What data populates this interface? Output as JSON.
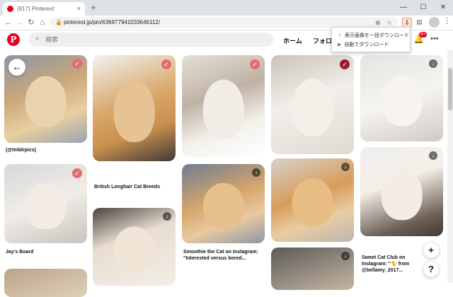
{
  "browser": {
    "tab_title": "(817) Pinterest",
    "tab_close": "×",
    "new_tab": "+",
    "url": "pinterest.jp/pin/636977941033646112/",
    "win_min": "—",
    "win_max": "☐",
    "win_close": "✕"
  },
  "pinterest": {
    "logo": "P",
    "search_placeholder": "検索",
    "nav_home": "ホーム",
    "nav_following": "フォロー",
    "notification_badge": "9+",
    "more": "•••"
  },
  "extension_menu": {
    "items": [
      {
        "icon": "download-icon",
        "label": "表示画像を一括ダウンロード"
      },
      {
        "icon": "play-icon",
        "label": "自動でダウンロード"
      }
    ]
  },
  "pins": {
    "captions": {
      "c1": "(@tmblrpics)",
      "c2": "British Longhair Cat Breeds",
      "c3": "Jay's Board",
      "c4": "Smoothie the Cat on Instagram: \"Interested versus bored...",
      "c5": "Sweet Cat Club on Instagram: \"🐈 from @bellamy_2017..."
    }
  },
  "floating": {
    "add": "+",
    "help": "?"
  },
  "colors": {
    "pinterest_red": "#e60023",
    "check_red": "#e56b6f"
  }
}
